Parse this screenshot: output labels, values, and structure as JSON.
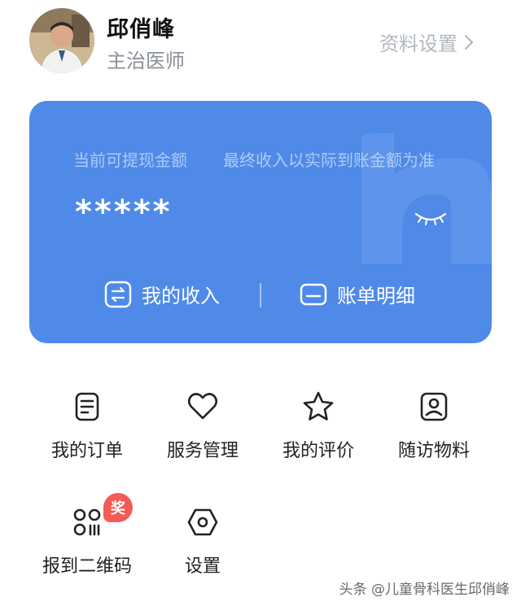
{
  "profile": {
    "name": "邱俏峰",
    "role": "主治医师",
    "settings_link": "资料设置"
  },
  "wallet": {
    "withdrawable_label": "当前可提现金额",
    "note": "最终收入以实际到账金额为准",
    "amount_masked": "*****",
    "actions": {
      "income": "我的收入",
      "bill": "账单明细"
    }
  },
  "menu": {
    "orders": "我的订单",
    "service": "服务管理",
    "reviews": "我的评价",
    "materials": "随访物料",
    "qrcode": "报到二维码",
    "settings": "设置",
    "badge": "奖"
  },
  "footer": {
    "watermark": "头条 @儿童骨科医生邱俏峰"
  },
  "colors": {
    "card_blue": "#4f8ae9",
    "badge_red": "#f25c54"
  }
}
